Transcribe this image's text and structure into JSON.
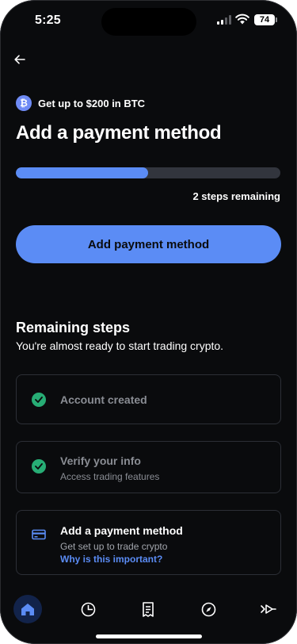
{
  "status_bar": {
    "time": "5:25",
    "battery": "74"
  },
  "promo": {
    "icon": "bitcoin-icon",
    "icon_glyph": "₿",
    "text": "Get up to $200 in BTC"
  },
  "page": {
    "title": "Add a payment method",
    "progress_fraction": 0.5,
    "steps_remaining": "2 steps remaining",
    "primary_button": "Add payment method"
  },
  "remaining": {
    "title": "Remaining steps",
    "subtitle": "You're almost ready to start trading crypto."
  },
  "steps": [
    {
      "title": "Account created",
      "subtitle": "",
      "status": "completed"
    },
    {
      "title": "Verify your info",
      "subtitle": "Access trading features",
      "status": "completed"
    },
    {
      "title": "Add a payment method",
      "subtitle": "Get set up to trade crypto",
      "link": "Why is this important?",
      "status": "pending"
    }
  ],
  "tabs": [
    {
      "icon": "home-icon",
      "active": true
    },
    {
      "icon": "pie-chart-icon",
      "active": false
    },
    {
      "icon": "receipt-icon",
      "active": false
    },
    {
      "icon": "compass-icon",
      "active": false
    },
    {
      "icon": "send-icon",
      "active": false
    }
  ],
  "colors": {
    "background": "#0a0b0d",
    "accent": "#5b8cf5",
    "success": "#27ad75",
    "card_border": "#2c2f36",
    "muted_text": "#8a8d94"
  }
}
